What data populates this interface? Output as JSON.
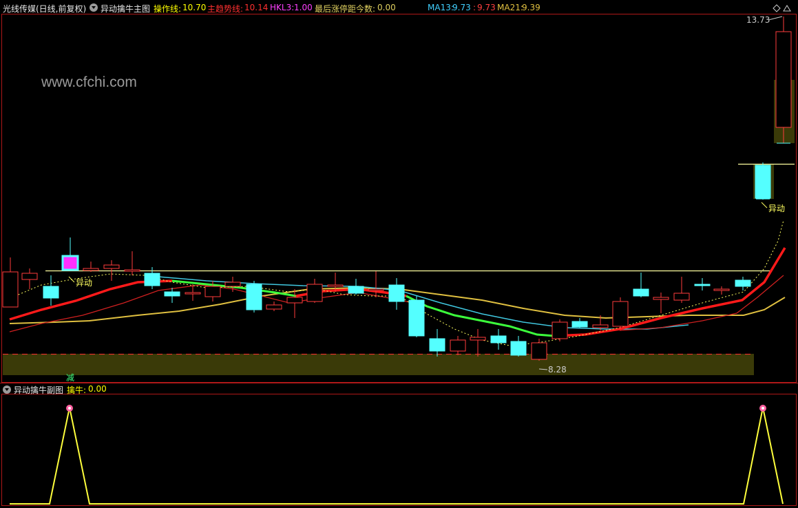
{
  "main_panel": {
    "stock_title": "光线传媒(日线,前复权)",
    "indicator_name": "异动擒牛主图",
    "readouts": [
      {
        "label": "操作线:",
        "value": "10.70",
        "color": "#ffff00"
      },
      {
        "label": "主趋势线:",
        "value": "10.14",
        "color": "#ff3030"
      },
      {
        "label": "HKL3:",
        "value": "1.00",
        "color": "#ff40ff"
      },
      {
        "label": "最后涨停距今数:",
        "value": "0.00",
        "color": "#e0d060"
      }
    ],
    "ma_readouts": [
      {
        "label": "MA13:",
        "value": "9.73",
        "color": "#40d0ff"
      },
      {
        "label": ":",
        "value": "9.73",
        "color": "#ff4040"
      },
      {
        "label": "MA21:",
        "value": "9.39",
        "color": "#e0c040"
      }
    ],
    "watermark": "www.cfchi.com",
    "high_label": "13.73",
    "low_label": "8.28",
    "signal_left": "异动",
    "signal_right": "异动",
    "bottom_tag": "减"
  },
  "sub_panel": {
    "indicator_name": "异动擒牛副图",
    "readout": {
      "label": "擒牛:",
      "value": "0.00",
      "color": "#ffff00"
    }
  },
  "colors": {
    "up": "#ff3c3c",
    "down": "#54ffff",
    "trend": "#ff1a1a",
    "op": "#3cff3c",
    "ma13": "#40c8e0",
    "ma21": "#e0c040",
    "yellow": "#ffff3c"
  }
}
